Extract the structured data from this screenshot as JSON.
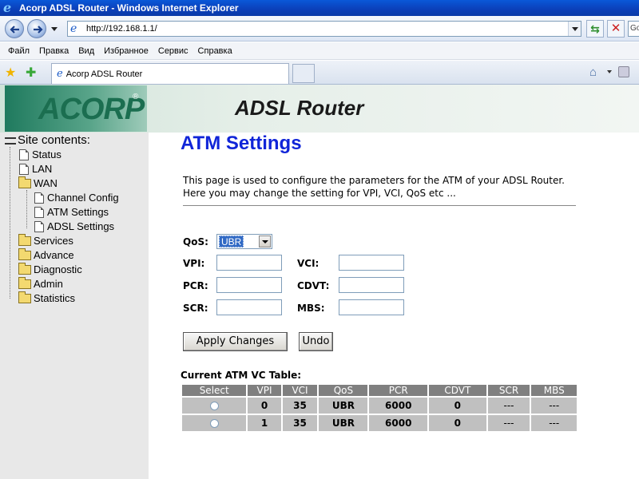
{
  "window": {
    "title": "Acorp ADSL Router - Windows Internet Explorer"
  },
  "address_bar": {
    "url": "http://192.168.1.1/",
    "search_partial": "Go"
  },
  "menu": [
    "Файл",
    "Правка",
    "Вид",
    "Избранное",
    "Сервис",
    "Справка"
  ],
  "tab": {
    "title": "Acorp ADSL Router"
  },
  "banner": {
    "logo": "ACORP",
    "logo_reg": "®",
    "title": "ADSL Router"
  },
  "sidebar": {
    "root": "Site contents:",
    "items": [
      "Status",
      "LAN",
      "WAN",
      "Channel Config",
      "ATM Settings",
      "ADSL Settings",
      "Services",
      "Advance",
      "Diagnostic",
      "Admin",
      "Statistics"
    ]
  },
  "page": {
    "title": "ATM Settings",
    "description": "This page is used to configure the parameters for the ATM of your ADSL Router. Here you may change the setting for VPI, VCI, QoS etc ..."
  },
  "form": {
    "qos_label": "QoS:",
    "qos_value": "UBR",
    "vpi_label": "VPI:",
    "vci_label": "VCI:",
    "pcr_label": "PCR:",
    "cdvt_label": "CDVT:",
    "scr_label": "SCR:",
    "mbs_label": "MBS:",
    "apply_label": "Apply Changes",
    "undo_label": "Undo"
  },
  "vc_table": {
    "title": "Current ATM VC Table:",
    "headers": [
      "Select",
      "VPI",
      "VCI",
      "QoS",
      "PCR",
      "CDVT",
      "SCR",
      "MBS"
    ],
    "rows": [
      {
        "vpi": "0",
        "vci": "35",
        "qos": "UBR",
        "pcr": "6000",
        "cdvt": "0",
        "scr": "---",
        "mbs": "---"
      },
      {
        "vpi": "1",
        "vci": "35",
        "qos": "UBR",
        "pcr": "6000",
        "cdvt": "0",
        "scr": "---",
        "mbs": "---"
      }
    ]
  },
  "colors": {
    "title_blue": "#1025d8",
    "header_gray": "#808080",
    "cell_gray": "#c0c0c0"
  }
}
